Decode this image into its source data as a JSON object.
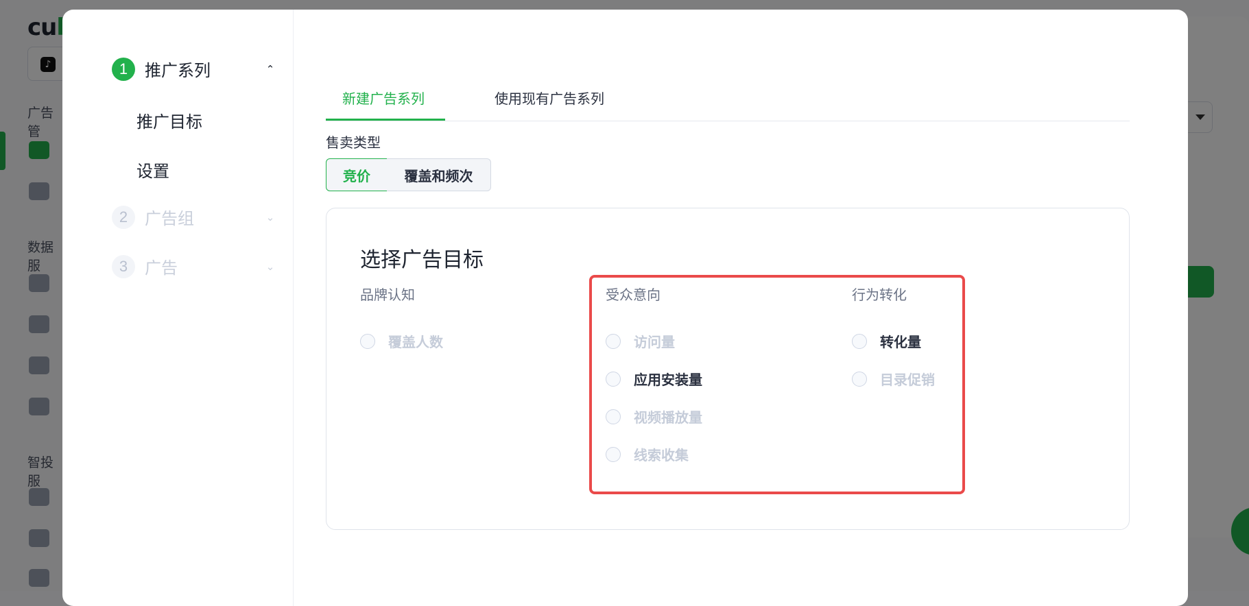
{
  "background": {
    "logo": {
      "prefix": "cu",
      "accent": "b"
    },
    "sections": [
      "广告管",
      "数据服",
      "智投服"
    ],
    "tiktok_glyph": "♪"
  },
  "steps": [
    {
      "number": "1",
      "label": "推广系列",
      "state": "active",
      "sub_items": [
        "推广目标",
        "设置"
      ]
    },
    {
      "number": "2",
      "label": "广告组",
      "state": "inactive"
    },
    {
      "number": "3",
      "label": "广告",
      "state": "inactive"
    }
  ],
  "tabs": [
    {
      "label": "新建广告系列",
      "active": true
    },
    {
      "label": "使用现有广告系列",
      "active": false
    }
  ],
  "sale_type": {
    "label": "售卖类型",
    "options": [
      {
        "label": "竞价",
        "selected": true
      },
      {
        "label": "覆盖和频次",
        "selected": false
      }
    ]
  },
  "goal_section": {
    "title": "选择广告目标",
    "columns": [
      {
        "header": "品牌认知",
        "options": [
          {
            "label": "覆盖人数",
            "enabled": false
          }
        ]
      },
      {
        "header": "受众意向",
        "options": [
          {
            "label": "访问量",
            "enabled": false
          },
          {
            "label": "应用安装量",
            "enabled": true
          },
          {
            "label": "视频播放量",
            "enabled": false
          },
          {
            "label": "线索收集",
            "enabled": false
          }
        ]
      },
      {
        "header": "行为转化",
        "options": [
          {
            "label": "转化量",
            "enabled": true
          },
          {
            "label": "目录促销",
            "enabled": false
          }
        ]
      }
    ]
  },
  "colors": {
    "accent": "#22b14c",
    "highlight": "#ea4a4a",
    "disabled_text": "#c5ccd9"
  }
}
